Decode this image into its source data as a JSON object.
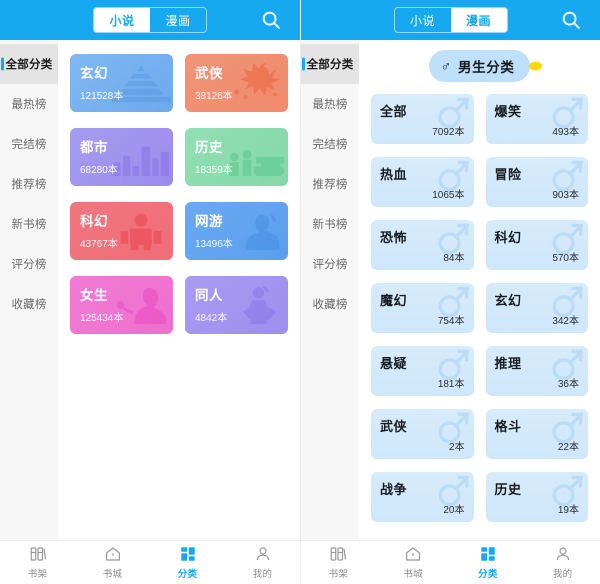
{
  "colors": {
    "brand_blue": "#17a9f0",
    "active_tab": "#17a9f0",
    "pill_bg": "#bfe0fa",
    "pill_dot": "#ffd900",
    "manga_card": "#d2e9fb",
    "sidebar_bg": "#f7f7f7"
  },
  "left_phone": {
    "topbar": {
      "segments": [
        {
          "label": "小说",
          "active": true
        },
        {
          "label": "漫画",
          "active": false
        }
      ],
      "search_icon": "search-icon"
    },
    "sidebar": {
      "items": [
        {
          "label": "全部分类",
          "active": true
        },
        {
          "label": "最热榜",
          "active": false
        },
        {
          "label": "完结榜",
          "active": false
        },
        {
          "label": "推荐榜",
          "active": false
        },
        {
          "label": "新书榜",
          "active": false
        },
        {
          "label": "评分榜",
          "active": false
        },
        {
          "label": "收藏榜",
          "active": false
        }
      ]
    },
    "categories": [
      {
        "name": "玄幻",
        "count": "121528本",
        "art": "pagoda-icon",
        "c1": "#7fb8f2",
        "c2": "#6fa9ee",
        "art_color": "#4a8fdc"
      },
      {
        "name": "武侠",
        "count": "38126本",
        "art": "swordsman-icon",
        "c1": "#f09478",
        "c2": "#ef8a6c",
        "art_color": "#ea4a1e"
      },
      {
        "name": "都市",
        "count": "68280本",
        "art": "cityscape-icon",
        "c1": "#a79bf0",
        "c2": "#9b8cec",
        "art_color": "#7a66e0"
      },
      {
        "name": "历史",
        "count": "18359本",
        "art": "army-icon",
        "c1": "#92dfb5",
        "c2": "#84d8a8",
        "art_color": "#3fbd7d"
      },
      {
        "name": "科幻",
        "count": "43767本",
        "art": "robot-icon",
        "c1": "#f0777f",
        "c2": "#ef6d78",
        "art_color": "#ec2b3a"
      },
      {
        "name": "网游",
        "count": "13496本",
        "art": "gamer-icon",
        "c1": "#69aaf0",
        "c2": "#5b9eee",
        "art_color": "#3a86e0"
      },
      {
        "name": "女生",
        "count": "125434本",
        "art": "girl-icon",
        "c1": "#f07bd6",
        "c2": "#ef6fcd",
        "art_color": "#e634ba"
      },
      {
        "name": "同人",
        "count": "4842本",
        "art": "fanart-icon",
        "c1": "#a99cf2",
        "c2": "#9e8eee",
        "art_color": "#7b68e2"
      }
    ]
  },
  "right_phone": {
    "topbar": {
      "segments": [
        {
          "label": "小说",
          "active": false
        },
        {
          "label": "漫画",
          "active": true
        }
      ],
      "search_icon": "search-icon"
    },
    "sidebar": {
      "items": [
        {
          "label": "全部分类",
          "active": true
        },
        {
          "label": "最热榜",
          "active": false
        },
        {
          "label": "完结榜",
          "active": false
        },
        {
          "label": "推荐榜",
          "active": false
        },
        {
          "label": "新书榜",
          "active": false
        },
        {
          "label": "评分榜",
          "active": false
        },
        {
          "label": "收藏榜",
          "active": false
        }
      ]
    },
    "gender_filter": {
      "label": "男生分类",
      "symbol": "♂",
      "icon": "male-symbol-icon"
    },
    "categories": [
      {
        "name": "全部",
        "count": "7092本"
      },
      {
        "name": "爆笑",
        "count": "493本"
      },
      {
        "name": "热血",
        "count": "1065本"
      },
      {
        "name": "冒险",
        "count": "903本"
      },
      {
        "name": "恐怖",
        "count": "84本"
      },
      {
        "name": "科幻",
        "count": "570本"
      },
      {
        "name": "魔幻",
        "count": "754本"
      },
      {
        "name": "玄幻",
        "count": "342本"
      },
      {
        "name": "悬疑",
        "count": "181本"
      },
      {
        "name": "推理",
        "count": "36本"
      },
      {
        "name": "武侠",
        "count": "2本"
      },
      {
        "name": "格斗",
        "count": "22本"
      },
      {
        "name": "战争",
        "count": "20本"
      },
      {
        "name": "历史",
        "count": "19本"
      }
    ]
  },
  "tabbar": {
    "items": [
      {
        "label": "书架",
        "icon": "bookshelf-icon",
        "active": false
      },
      {
        "label": "书城",
        "icon": "bookstore-home-icon",
        "active": false
      },
      {
        "label": "分类",
        "icon": "grid-category-icon",
        "active": true
      },
      {
        "label": "我的",
        "icon": "user-profile-icon",
        "active": false
      }
    ]
  }
}
